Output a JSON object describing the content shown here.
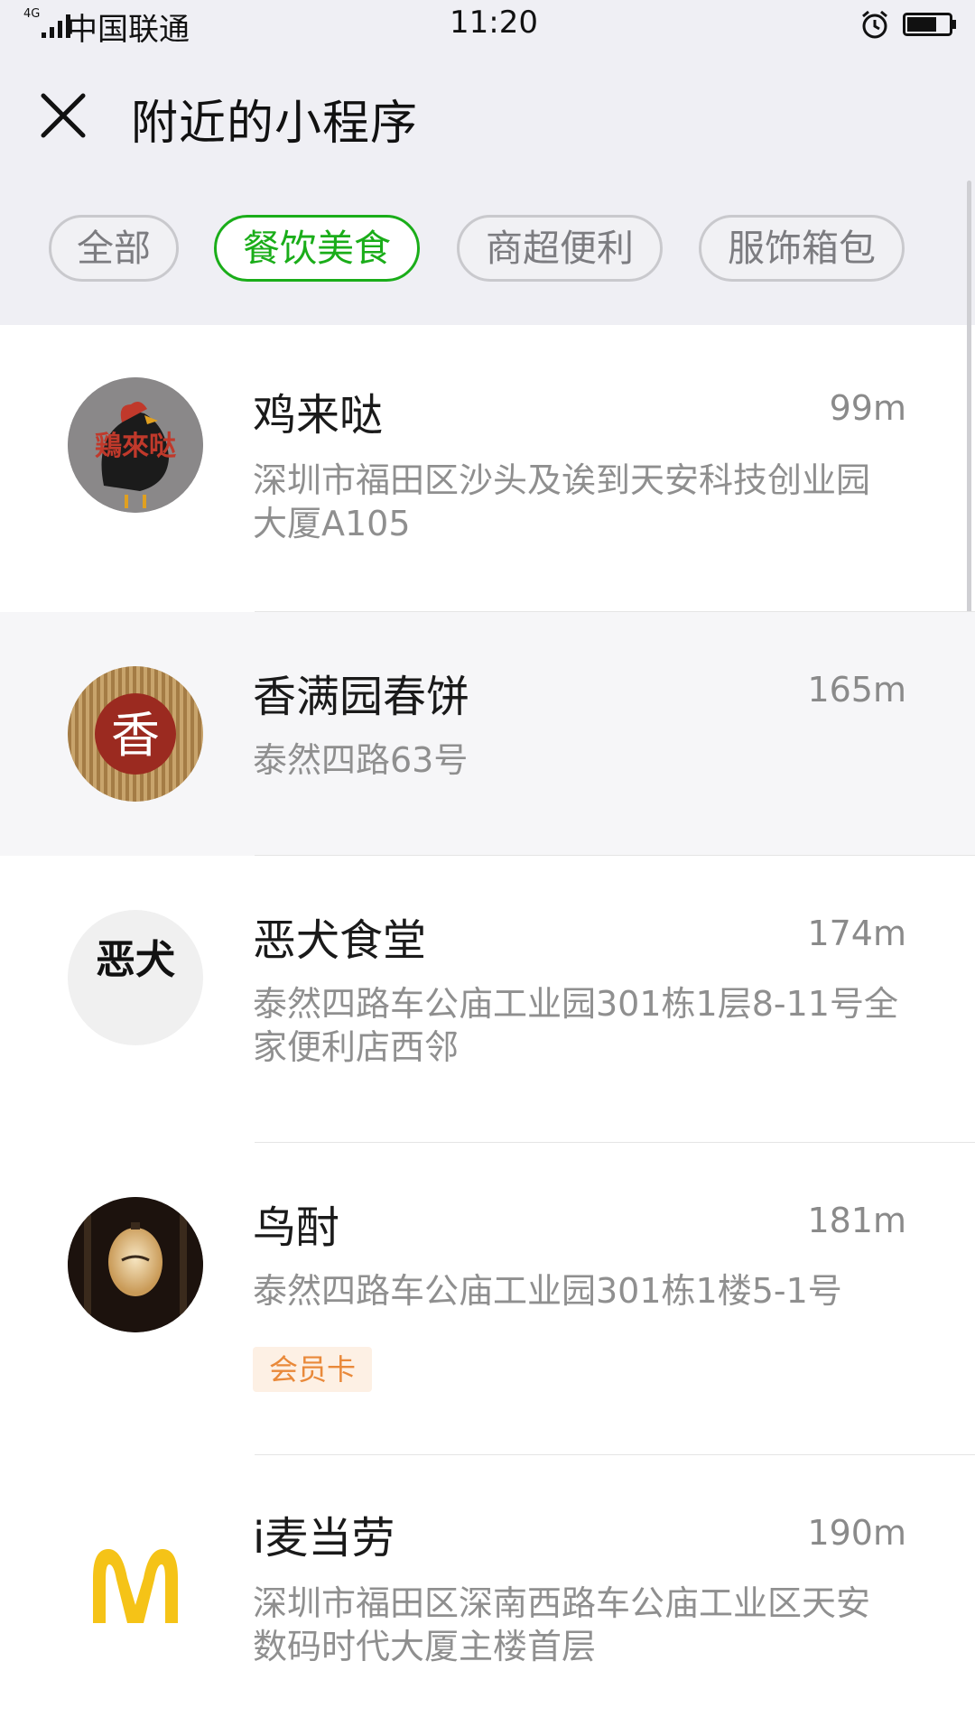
{
  "status_bar": {
    "network": "4G",
    "carrier": "中国联通",
    "time": "11:20"
  },
  "header": {
    "title": "附近的小程序",
    "close_icon": "close-icon"
  },
  "filters": [
    {
      "label": "全部",
      "active": false
    },
    {
      "label": "餐饮美食",
      "active": true
    },
    {
      "label": "商超便利",
      "active": false
    },
    {
      "label": "服饰箱包",
      "active": false
    }
  ],
  "colors": {
    "accent": "#1aad19",
    "badge_text": "#e9893a",
    "badge_bg": "#fdf0e4"
  },
  "items": [
    {
      "name": "鸡来哒",
      "distance": "99m",
      "address": "深圳市福田区沙头及诶到天安科技创业园大厦A105",
      "logo_text": "鶏來哒"
    },
    {
      "name": "香满园春饼",
      "distance": "165m",
      "address": "泰然四路63号",
      "logo_text": "香"
    },
    {
      "name": "恶犬食堂",
      "distance": "174m",
      "address": "泰然四路车公庙工业园301栋1层8-11号全家便利店西邻",
      "logo_text": "恶犬"
    },
    {
      "name": "鸟酎",
      "distance": "181m",
      "address": "泰然四路车公庙工业园301栋1楼5-1号",
      "badge": "会员卡"
    },
    {
      "name": "i麦当劳",
      "distance": "190m",
      "address": "深圳市福田区深南西路车公庙工业区天安数码时代大厦主楼首层"
    }
  ]
}
